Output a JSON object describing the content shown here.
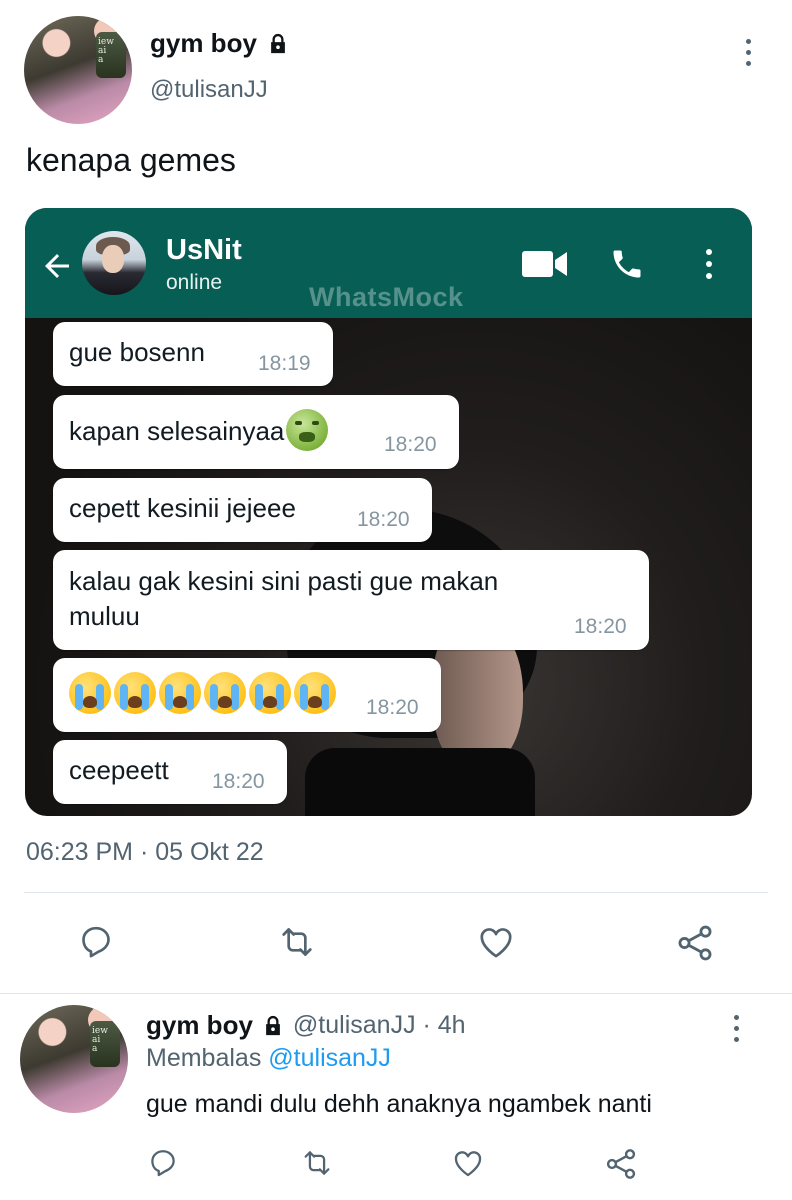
{
  "tweet": {
    "display_name": "gym boy",
    "handle": "@tulisanJJ",
    "text": "kenapa gemes",
    "timestamp": "06:23 PM · 05 Okt 22",
    "avatar_jar_text": "iew\nai\na"
  },
  "chat_screenshot": {
    "contact_name": "UsNit",
    "status": "online",
    "watermark": "WhatsMock",
    "messages": [
      {
        "text": "gue bosenn",
        "time": "18:19"
      },
      {
        "text": "kapan selesainyaa",
        "emoji": "nauseated-face",
        "time": "18:20"
      },
      {
        "text": "cepett kesinii jejeee",
        "time": "18:20"
      },
      {
        "text_line1": "kalau gak kesini sini pasti gue makan",
        "text_line2": "muluu",
        "time": "18:20"
      },
      {
        "emoji": "loudly-crying-face",
        "emoji_count": 6,
        "time": "18:20"
      },
      {
        "text": "ceepeett",
        "time": "18:20"
      }
    ]
  },
  "reply": {
    "display_name": "gym boy",
    "handle_time": "@tulisanJJ · 4h",
    "replying_to_prefix": "Membalas",
    "replying_to_handle": "@tulisanJJ",
    "text": "gue mandi dulu dehh anaknya ngambek nanti"
  },
  "icons": {
    "lock": "lock-icon",
    "more": "more-vertical-icon",
    "reply": "comment-icon",
    "retweet": "retweet-icon",
    "like": "heart-icon",
    "share": "share-icon"
  },
  "colors": {
    "whatsapp_header": "#075e54",
    "text_secondary": "#536471",
    "mention": "#1d9bf0",
    "bubble": "#ffffff",
    "bubble_time": "#8696a0"
  }
}
